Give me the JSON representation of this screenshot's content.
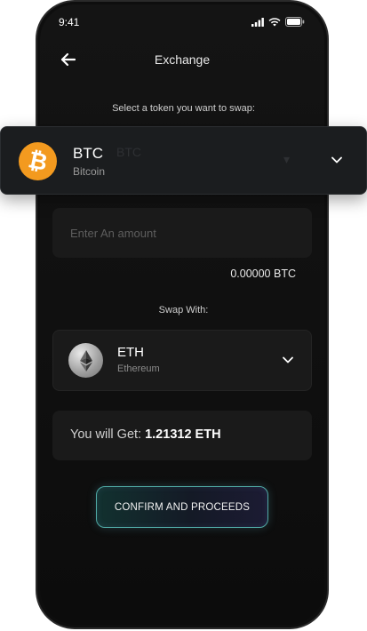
{
  "status_bar": {
    "time": "9:41",
    "icons": [
      "signal-icon",
      "wifi-icon",
      "battery-icon"
    ]
  },
  "header": {
    "title": "Exchange",
    "back_icon": "arrow-left-icon"
  },
  "select_prompt": "Select a token you want to swap:",
  "from_token": {
    "symbol": "BTC",
    "name": "Bitcoin",
    "icon": "bitcoin-icon",
    "icon_color": "#f39a1f"
  },
  "amount": {
    "placeholder": "Enter An amount",
    "value": ""
  },
  "balance": "0.00000 BTC",
  "swap_label": "Swap With:",
  "to_token": {
    "symbol": "ETH",
    "name": "Ethereum",
    "icon": "ethereum-icon"
  },
  "result": {
    "label": "You will Get:",
    "value": "1.21312 ETH"
  },
  "confirm_button": {
    "label": "CONFIRM AND PROCEEDS",
    "border_color": "#4fa9a4"
  }
}
